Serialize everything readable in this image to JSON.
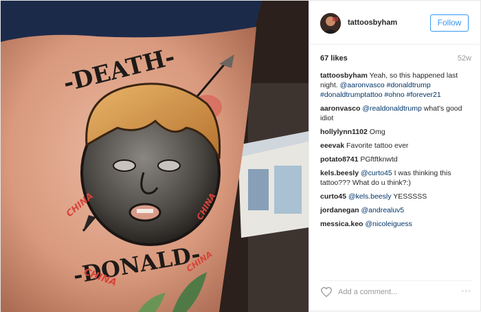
{
  "post": {
    "username": "tattoosbyham",
    "follow_label": "Follow",
    "likes": "67 likes",
    "age": "52w"
  },
  "comments": [
    {
      "user": "tattoosbyham",
      "parts": [
        {
          "t": "text",
          "v": "Yeah, so this happened last night. "
        },
        {
          "t": "link",
          "v": "@aaronvasco"
        },
        {
          "t": "text",
          "v": " "
        },
        {
          "t": "link",
          "v": "#donaldtrump"
        },
        {
          "t": "text",
          "v": " "
        },
        {
          "t": "link",
          "v": "#donaldtrumptattoo"
        },
        {
          "t": "text",
          "v": " "
        },
        {
          "t": "link",
          "v": "#ohno"
        },
        {
          "t": "text",
          "v": " "
        },
        {
          "t": "link",
          "v": "#forever21"
        }
      ]
    },
    {
      "user": "aaronvasco",
      "parts": [
        {
          "t": "link",
          "v": "@realdonaldtrump"
        },
        {
          "t": "text",
          "v": " what's good idiot"
        }
      ]
    },
    {
      "user": "hollylynn1102",
      "parts": [
        {
          "t": "text",
          "v": "Omg"
        }
      ]
    },
    {
      "user": "eeevak",
      "parts": [
        {
          "t": "text",
          "v": "Favorite tattoo ever"
        }
      ]
    },
    {
      "user": "potato8741",
      "parts": [
        {
          "t": "text",
          "v": "PGftftknwtd"
        }
      ]
    },
    {
      "user": "kels.beesly",
      "parts": [
        {
          "t": "link",
          "v": "@curto45"
        },
        {
          "t": "text",
          "v": " I was thinking this tattoo??? What do u think?:)"
        }
      ]
    },
    {
      "user": "curto45",
      "parts": [
        {
          "t": "link",
          "v": "@kels.beesly"
        },
        {
          "t": "text",
          "v": " YESSSSS"
        }
      ]
    },
    {
      "user": "jordanegan",
      "parts": [
        {
          "t": "link",
          "v": "@andrealuv5"
        }
      ]
    },
    {
      "user": "messica.keo",
      "parts": [
        {
          "t": "link",
          "v": "@nicoleiguess"
        }
      ]
    }
  ],
  "footer": {
    "add_comment_placeholder": "Add a comment...",
    "more_label": "◦◦◦",
    "heart_icon": "heart-outline-icon"
  },
  "photo": {
    "tattoo_words": {
      "top": "-DEATH-",
      "bottom": "-DONALD-",
      "red_1": "CHINA",
      "red_2": "CHINA",
      "red_3": "CHINA",
      "red_4": "CHINA"
    }
  },
  "colors": {
    "accent": "#3897f0",
    "link": "#003569",
    "muted": "#999999"
  }
}
